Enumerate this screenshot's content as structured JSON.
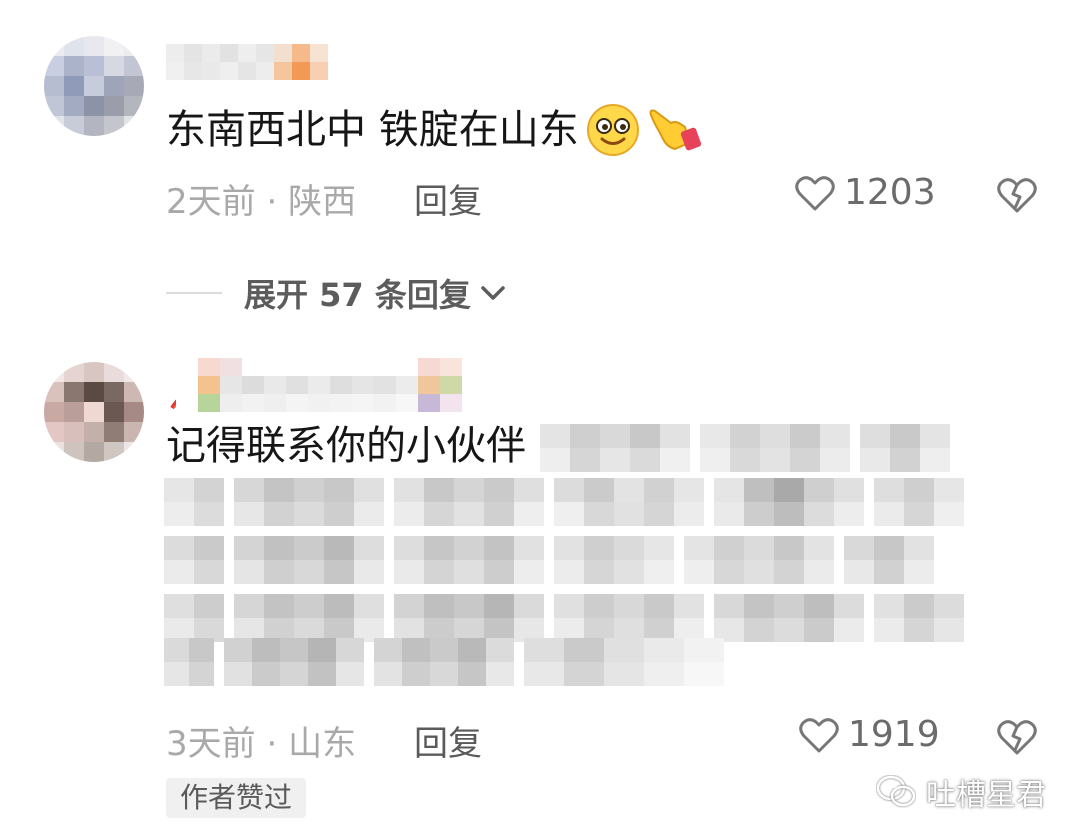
{
  "comments": [
    {
      "text": "东南西北中 铁腚在山东",
      "emoji_icons": [
        "smiling-face-emoji-icon",
        "pointing-hand-emoji-icon"
      ],
      "time": "2天前",
      "separator": "·",
      "location": "陕西",
      "reply_label": "回复",
      "likes": "1203"
    },
    {
      "text": "记得联系你的小伙伴",
      "time": "3天前",
      "separator": "·",
      "location": "山东",
      "reply_label": "回复",
      "likes": "1919",
      "badge": "作者赞过"
    }
  ],
  "expand_replies": {
    "label": "展开 57 条回复"
  },
  "watermark": {
    "text": "吐槽星君"
  },
  "colors": {
    "text_primary": "#161616",
    "text_meta": "#a9a9a9",
    "badge_bg": "#f0f0f0"
  }
}
